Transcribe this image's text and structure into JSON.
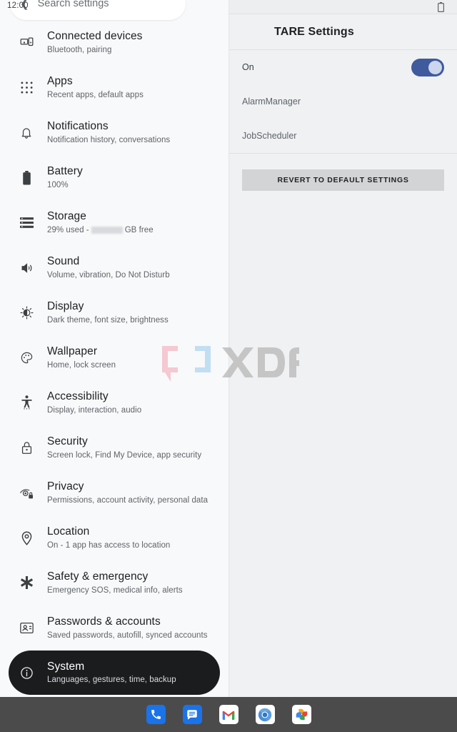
{
  "status_bar": {
    "time": "12:00",
    "battery_icon": "battery-outline-icon"
  },
  "search": {
    "back_icon": "chevron-left-icon",
    "placeholder": "Search settings",
    "value": "Search settings"
  },
  "sidebar": {
    "items": [
      {
        "icon": "connected-devices-icon",
        "title": "Connected devices",
        "subtitle": "Bluetooth, pairing",
        "selected": false
      },
      {
        "icon": "apps-grid-icon",
        "title": "Apps",
        "subtitle": "Recent apps, default apps",
        "selected": false
      },
      {
        "icon": "bell-icon",
        "title": "Notifications",
        "subtitle": "Notification history, conversations",
        "selected": false
      },
      {
        "icon": "battery-icon",
        "title": "Battery",
        "subtitle": "100%",
        "selected": false
      },
      {
        "icon": "storage-icon",
        "title": "Storage",
        "subtitle_prefix": "29% used - ",
        "subtitle_redacted": true,
        "subtitle_suffix": "GB free",
        "selected": false
      },
      {
        "icon": "speaker-icon",
        "title": "Sound",
        "subtitle": "Volume, vibration, Do Not Disturb",
        "selected": false
      },
      {
        "icon": "brightness-icon",
        "title": "Display",
        "subtitle": "Dark theme, font size, brightness",
        "selected": false
      },
      {
        "icon": "palette-icon",
        "title": "Wallpaper",
        "subtitle": "Home, lock screen",
        "selected": false
      },
      {
        "icon": "accessibility-icon",
        "title": "Accessibility",
        "subtitle": "Display, interaction, audio",
        "selected": false
      },
      {
        "icon": "lock-icon",
        "title": "Security",
        "subtitle": "Screen lock, Find My Device, app security",
        "selected": false
      },
      {
        "icon": "privacy-eye-icon",
        "title": "Privacy",
        "subtitle": "Permissions, account activity, personal data",
        "selected": false
      },
      {
        "icon": "location-pin-icon",
        "title": "Location",
        "subtitle": "On - 1 app has access to location",
        "selected": false
      },
      {
        "icon": "asterisk-icon",
        "title": "Safety & emergency",
        "subtitle": "Emergency SOS, medical info, alerts",
        "selected": false
      },
      {
        "icon": "account-card-icon",
        "title": "Passwords & accounts",
        "subtitle": "Saved passwords, autofill, synced accounts",
        "selected": false
      },
      {
        "icon": "info-circle-icon",
        "title": "System",
        "subtitle": "Languages, gestures, time, backup",
        "selected": true
      }
    ]
  },
  "detail": {
    "title": "TARE Settings",
    "rows": [
      {
        "label": "On",
        "type": "switch",
        "checked": true
      },
      {
        "label": "AlarmManager",
        "type": "link"
      },
      {
        "label": "JobScheduler",
        "type": "link"
      }
    ],
    "revert_button": "REVERT TO DEFAULT SETTINGS"
  },
  "watermark": {
    "text": "XDA"
  },
  "taskbar": {
    "apps": [
      {
        "name": "phone-app-icon",
        "label": "Phone"
      },
      {
        "name": "messages-app-icon",
        "label": "Messages"
      },
      {
        "name": "gmail-app-icon",
        "label": "Gmail"
      },
      {
        "name": "chrome-app-icon",
        "label": "Chrome"
      },
      {
        "name": "photos-app-icon",
        "label": "Photos"
      }
    ]
  },
  "colors": {
    "accent_blue": "#3f5a9d",
    "left_bg": "#f8f9fa",
    "right_bg": "#eff1f3",
    "selected_pill": "#1b1c1e",
    "taskbar_bg": "#4b4b4b",
    "button_gray": "#d2d4d6"
  }
}
